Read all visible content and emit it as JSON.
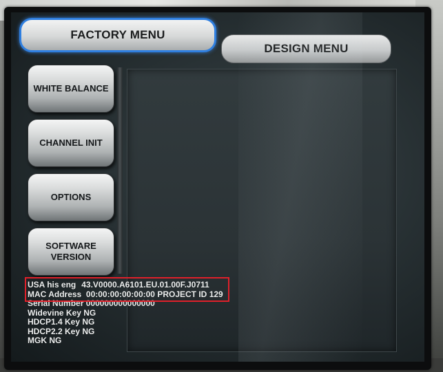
{
  "tabs": {
    "factory_menu": "FACTORY MENU",
    "design_menu": "DESIGN MENU"
  },
  "menu": {
    "white_balance": "WHITE BALANCE",
    "channel_init": "CHANNEL INIT",
    "options": "OPTIONS",
    "software_version": "SOFTWARE VERSION"
  },
  "info": {
    "usa_label": "USA his eng",
    "usa_value": "43.V0000.A6101.EU.01.00F.J0711",
    "mac_label": "MAC Address",
    "mac_value": "00:00:00:00:00:00",
    "project_label": "PROJECT ID",
    "project_value": "129",
    "serial_label": "Serial Number",
    "serial_value": "000000000000000",
    "widevine_label": "Widevine Key",
    "widevine_value": "NG",
    "hdcp14_label": "HDCP1.4 Key",
    "hdcp14_value": "NG",
    "hdcp22_label": "HDCP2.2 Key",
    "hdcp22_value": "NG",
    "mgk_label": "MGK",
    "mgk_value": "NG"
  },
  "colors": {
    "selected_tab_outline": "#2f7fe0",
    "annotation_box": "#e0202a",
    "screen_bg": "#283134"
  }
}
